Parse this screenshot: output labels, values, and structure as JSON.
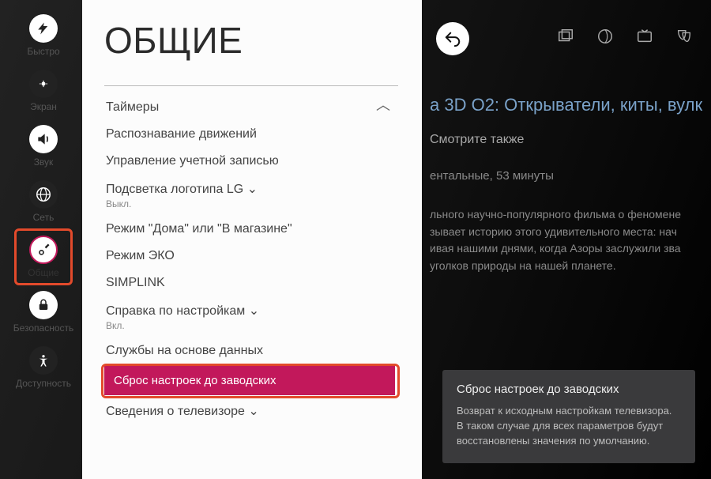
{
  "rail": [
    {
      "id": "quick",
      "label": "Быстро"
    },
    {
      "id": "screen",
      "label": "Экран"
    },
    {
      "id": "sound",
      "label": "Звук"
    },
    {
      "id": "network",
      "label": "Сеть"
    },
    {
      "id": "general",
      "label": "Общие",
      "active": true
    },
    {
      "id": "safety",
      "label": "Безопасность"
    },
    {
      "id": "access",
      "label": "Доступность"
    }
  ],
  "panel": {
    "title": "ОБЩИЕ",
    "scroll_hint": "︿",
    "items": [
      {
        "label": "Таймеры"
      },
      {
        "label": "Распознавание движений"
      },
      {
        "label": "Управление учетной записью"
      },
      {
        "label": "Подсветка логотипа LG ⌄",
        "sub": "Выкл."
      },
      {
        "label": "Режим \"Дома\" или \"В магазине\""
      },
      {
        "label": "Режим ЭКО"
      },
      {
        "label": "SIMPLINK"
      },
      {
        "label": "Справка по настройкам ⌄",
        "sub": "Вкл."
      },
      {
        "label": "Службы на основе данных"
      },
      {
        "label": "Сброс настроек до заводских",
        "selected": true
      },
      {
        "label": "Сведения о телевизоре ⌄"
      }
    ]
  },
  "background": {
    "title_fragment": "а 3D О2: Открыватели, киты, вулк",
    "see_also": "Смотрите также",
    "meta": "ентальные, 53 минуты",
    "desc_l1": "льного научно-популярного фильма о феномене",
    "desc_l2": "зывает историю этого удивительного места: нач",
    "desc_l3": "ивая нашими днями, когда Азоры заслужили зва",
    "desc_l4": "уголков природы на нашей планете."
  },
  "tooltip": {
    "title": "Сброс настроек до заводских",
    "body": "Возврат к исходным настройкам телевизора. В таком случае для всех параметров будут восстановлены значения по умолчанию."
  }
}
